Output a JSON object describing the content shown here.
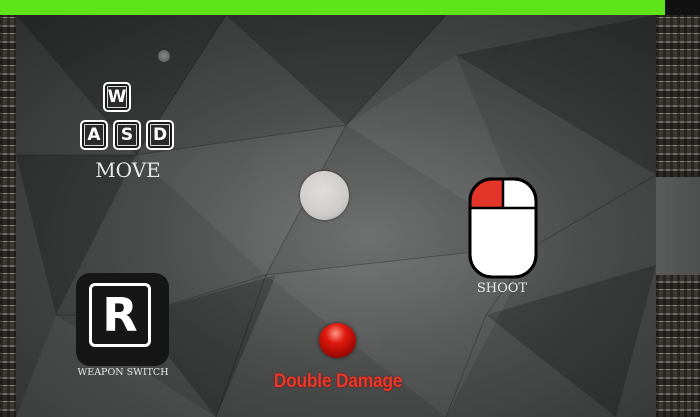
{
  "hud": {
    "health_fraction": 0.95,
    "health_color": "#5ee318"
  },
  "controls": {
    "move_keys": [
      "W",
      "A",
      "S",
      "D"
    ],
    "move_label": "MOVE",
    "shoot_label": "SHOOT",
    "weapon_key": "R",
    "weapon_label": "WEAPON SWITCH"
  },
  "pickup": {
    "label": "Double Damage",
    "color": "#e53a2c"
  },
  "player": {
    "color": "#d9d6d5"
  }
}
